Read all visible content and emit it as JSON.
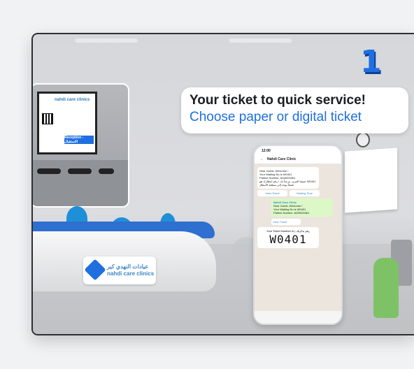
{
  "step_number": "1",
  "headline": {
    "line1": "Your ticket to quick service!",
    "line2": "Choose paper or digital ticket"
  },
  "kiosk": {
    "brand": "nahdi care clinics",
    "button": "Reception - الاستقبال"
  },
  "desk_sign": {
    "arabic": "عيادات النهدي كير",
    "english": "nahdi care clinics"
  },
  "phone": {
    "time": "12:00",
    "contact": "Nahdi Care Clinic",
    "message1": {
      "greeting": "Dear Guest, Welcome !",
      "waiting": "Your Waiting No is W0401",
      "patient": "Patient Number JA00000461",
      "arabic": "ضيفنا العزيز، مرحباً بك ! رقم انتظارك هو W0401 فضلاً توجه إلى منطقة الانتظار"
    },
    "buttons": [
      "View Ticket",
      "Waiting Time"
    ],
    "message2": {
      "title": "Nahdi Care Clinic",
      "greeting": "Dear Guest, Welcome !",
      "waiting": "Your Waiting No is W0401",
      "patient": "Patient Number JA00000461"
    },
    "view_ticket": "View Ticket",
    "ticket": {
      "label": "Your Ticket Number Is | رقم تذكرتك",
      "number": "W0401"
    }
  },
  "colors": {
    "accent": "#1f6fe0",
    "frame": "#2d2f36",
    "chat_bg": "#ece5dd"
  }
}
